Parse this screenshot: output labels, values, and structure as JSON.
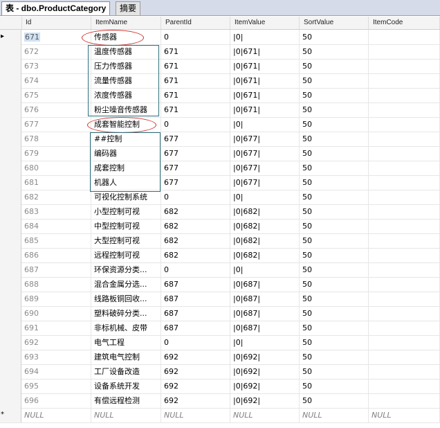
{
  "tabs": [
    {
      "label": "表 - dbo.ProductCategory"
    },
    {
      "label": "摘要"
    }
  ],
  "columns": [
    "Id",
    "ItemName",
    "ParentId",
    "ItemValue",
    "SortValue",
    "ItemCode"
  ],
  "rows": [
    {
      "id": "671",
      "name": "传感器",
      "parent": "0",
      "value": "|0|",
      "sort": "50",
      "code": ""
    },
    {
      "id": "672",
      "name": "温度传感器",
      "parent": "671",
      "value": "|0|671|",
      "sort": "50",
      "code": ""
    },
    {
      "id": "673",
      "name": "压力传感器",
      "parent": "671",
      "value": "|0|671|",
      "sort": "50",
      "code": ""
    },
    {
      "id": "674",
      "name": "流量传感器",
      "parent": "671",
      "value": "|0|671|",
      "sort": "50",
      "code": ""
    },
    {
      "id": "675",
      "name": "浓度传感器",
      "parent": "671",
      "value": "|0|671|",
      "sort": "50",
      "code": ""
    },
    {
      "id": "676",
      "name": "粉尘噪音传感器",
      "parent": "671",
      "value": "|0|671|",
      "sort": "50",
      "code": ""
    },
    {
      "id": "677",
      "name": "成套智能控制",
      "parent": "0",
      "value": "|0|",
      "sort": "50",
      "code": ""
    },
    {
      "id": "678",
      "name": "##控制",
      "parent": "677",
      "value": "|0|677|",
      "sort": "50",
      "code": ""
    },
    {
      "id": "679",
      "name": "编码器",
      "parent": "677",
      "value": "|0|677|",
      "sort": "50",
      "code": ""
    },
    {
      "id": "680",
      "name": "成套控制",
      "parent": "677",
      "value": "|0|677|",
      "sort": "50",
      "code": ""
    },
    {
      "id": "681",
      "name": "机器人",
      "parent": "677",
      "value": "|0|677|",
      "sort": "50",
      "code": ""
    },
    {
      "id": "682",
      "name": "可视化控制系统",
      "parent": "0",
      "value": "|0|",
      "sort": "50",
      "code": ""
    },
    {
      "id": "683",
      "name": "小型控制可视",
      "parent": "682",
      "value": "|0|682|",
      "sort": "50",
      "code": ""
    },
    {
      "id": "684",
      "name": "中型控制可视",
      "parent": "682",
      "value": "|0|682|",
      "sort": "50",
      "code": ""
    },
    {
      "id": "685",
      "name": "大型控制可视",
      "parent": "682",
      "value": "|0|682|",
      "sort": "50",
      "code": ""
    },
    {
      "id": "686",
      "name": "远程控制可视",
      "parent": "682",
      "value": "|0|682|",
      "sort": "50",
      "code": ""
    },
    {
      "id": "687",
      "name": "环保资源分类...",
      "parent": "0",
      "value": "|0|",
      "sort": "50",
      "code": ""
    },
    {
      "id": "688",
      "name": "混合金属分选...",
      "parent": "687",
      "value": "|0|687|",
      "sort": "50",
      "code": ""
    },
    {
      "id": "689",
      "name": "线路板铜回收...",
      "parent": "687",
      "value": "|0|687|",
      "sort": "50",
      "code": ""
    },
    {
      "id": "690",
      "name": "塑料破碎分类...",
      "parent": "687",
      "value": "|0|687|",
      "sort": "50",
      "code": ""
    },
    {
      "id": "691",
      "name": "非标机械、皮带",
      "parent": "687",
      "value": "|0|687|",
      "sort": "50",
      "code": ""
    },
    {
      "id": "692",
      "name": "电气工程",
      "parent": "0",
      "value": "|0|",
      "sort": "50",
      "code": ""
    },
    {
      "id": "693",
      "name": "建筑电气控制",
      "parent": "692",
      "value": "|0|692|",
      "sort": "50",
      "code": ""
    },
    {
      "id": "694",
      "name": "工厂设备改造",
      "parent": "692",
      "value": "|0|692|",
      "sort": "50",
      "code": ""
    },
    {
      "id": "695",
      "name": "设备系统开发",
      "parent": "692",
      "value": "|0|692|",
      "sort": "50",
      "code": ""
    },
    {
      "id": "696",
      "name": "有偿远程检测",
      "parent": "692",
      "value": "|0|692|",
      "sort": "50",
      "code": ""
    }
  ],
  "new_row": {
    "marker": "*",
    "id": "NULL",
    "name": "NULL",
    "parent": "NULL",
    "value": "NULL",
    "sort": "NULL",
    "code": "NULL"
  },
  "current_row_marker": "▸",
  "icons": {
    "current_row": "row-pointer-icon",
    "new_row": "new-row-asterisk-icon"
  },
  "annotation_color": "#d2302a"
}
